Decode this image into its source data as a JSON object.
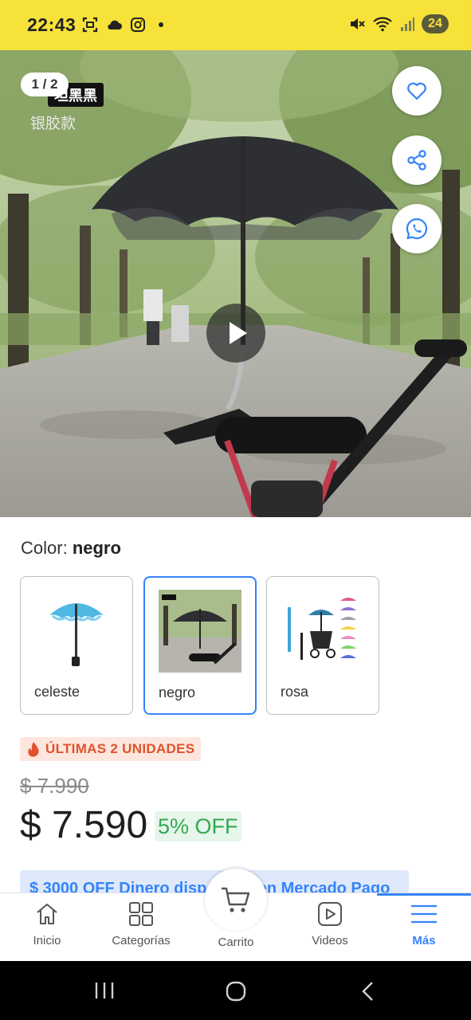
{
  "status_bar": {
    "time": "22:43",
    "battery": "24",
    "icons_left": [
      "screenshot-icon",
      "cloud-icon",
      "instagram-icon",
      "dot-icon"
    ],
    "icons_right": [
      "mute-icon",
      "wifi-icon",
      "signal-icon"
    ]
  },
  "gallery": {
    "pager": "1 / 2",
    "image_text_dark": "坦黑黑",
    "image_text_light": "银胶款",
    "actions": [
      "heart-icon",
      "share-icon",
      "whatsapp-icon"
    ],
    "play": "play-icon"
  },
  "variants": {
    "label": "Color:",
    "selected": "negro",
    "options": [
      {
        "label": "celeste"
      },
      {
        "label": "negro",
        "selected": true
      },
      {
        "label": "rosa"
      }
    ]
  },
  "stock_badge": "ÚLTIMAS 2 UNIDADES",
  "price": {
    "old": "$ 7.990",
    "current": "$ 7.590",
    "discount": "5% OFF"
  },
  "promo": "$ 3000 OFF Dinero disponible en Mercado Pago",
  "bottom_nav": {
    "items": [
      {
        "label": "Inicio",
        "icon": "home-icon"
      },
      {
        "label": "Categorías",
        "icon": "grid-icon"
      },
      {
        "label": "Carrito",
        "icon": "cart-icon"
      },
      {
        "label": "Videos",
        "icon": "video-icon"
      },
      {
        "label": "Más",
        "icon": "menu-icon",
        "active": true
      }
    ]
  },
  "colors": {
    "brand_yellow": "#f7e23a",
    "accent_blue": "#3483fa",
    "discount_green": "#34a853",
    "badge_orange": "#e0522b"
  }
}
